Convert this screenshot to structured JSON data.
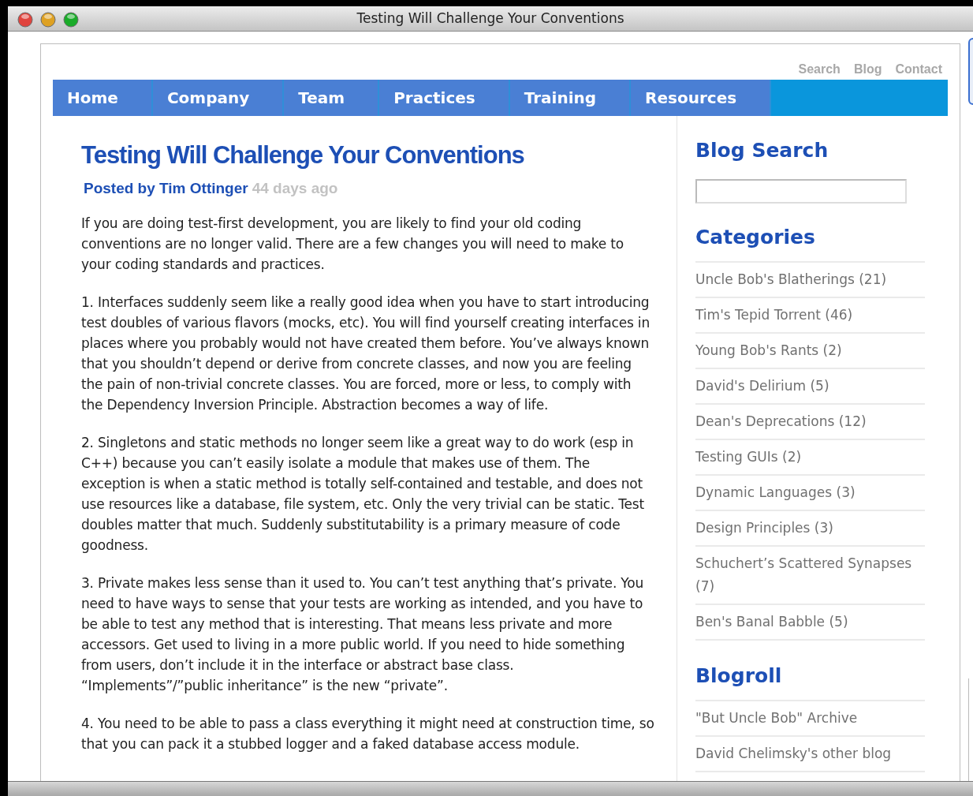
{
  "window": {
    "title": "Testing Will Challenge Your Conventions"
  },
  "top_links": [
    "Search",
    "Blog",
    "Contact"
  ],
  "nav": [
    {
      "label": "Home"
    },
    {
      "label": "Company"
    },
    {
      "label": "Team"
    },
    {
      "label": "Practices"
    },
    {
      "label": "Training"
    },
    {
      "label": "Resources"
    }
  ],
  "post": {
    "title": "Testing Will Challenge Your Conventions",
    "author": "Posted by Tim Ottinger",
    "age": "44 days ago",
    "paragraphs": [
      "If you are doing test-first development, you are likely to find your old coding conventions are no longer valid. There are a few changes you will need to make to your coding standards and practices.",
      "1. Interfaces suddenly seem like a really good idea when you have to start introducing test doubles of various flavors (mocks, etc). You will find yourself creating interfaces in places where you probably would not have created them before. You’ve always known that you shouldn’t depend or derive from concrete classes, and now you are feeling the pain of non-trivial concrete classes. You are forced, more or less, to comply with the Dependency Inversion Principle. Abstraction becomes a way of life.",
      "2. Singletons and static methods no longer seem like a great way to do work (esp in C++) because you can’t easily isolate a module that makes use of them. The exception is when a static method is totally self-contained and testable, and does not use resources like a database, file system, etc. Only the very trivial can be static. Test doubles matter that much. Suddenly substitutability is a primary measure of code goodness.",
      "3. Private makes less sense than it used to. You can’t test anything that’s private. You need to have ways to sense that your tests are working as intended, and you have to be able to test any method that is interesting. That means less private and more accessors. Get used to living in a more public world. If you need to hide something from users, don’t include it in the interface or abstract base class. “Implements”/”public inheritance” is the new “private”.",
      "4. You need to be able to pass a class everything it might need at construction time, so that you can pack it a stubbed logger and a faked database access module."
    ]
  },
  "sidebar": {
    "search_heading": "Blog Search",
    "categories_heading": "Categories",
    "categories": [
      "Uncle Bob's Blatherings (21)",
      "Tim's Tepid Torrent (46)",
      "Young Bob's Rants (2)",
      "David's Delirium (5)",
      "Dean's Deprecations (12)",
      "Testing GUIs (2)",
      "Dynamic Languages (3)",
      "Design Principles (3)",
      "Schuchert’s Scattered Synapses (7)",
      "Ben's Banal Babble (5)"
    ],
    "blogroll_heading": "Blogroll",
    "blogroll": [
      "\"But Uncle Bob\" Archive",
      "David Chelimsky's other blog"
    ]
  }
}
